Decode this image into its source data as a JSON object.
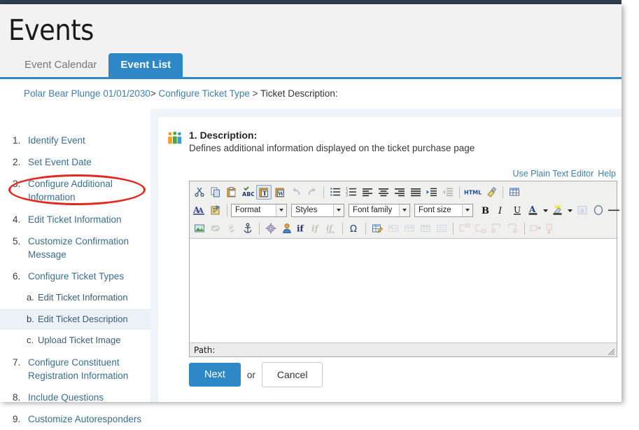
{
  "header": {
    "title": "Events",
    "tabs": [
      {
        "label": "Event Calendar",
        "active": false
      },
      {
        "label": "Event List",
        "active": true
      }
    ]
  },
  "breadcrumb": {
    "item1": "Polar Bear Plunge 01/01/2030",
    "sep1": ">",
    "item2": "Configure Ticket Type",
    "sep2": ">",
    "current": "Ticket Description:"
  },
  "sidebar": {
    "items": [
      {
        "num": "1.",
        "label": "Identify Event",
        "sub": false,
        "highlight": false
      },
      {
        "num": "2.",
        "label": "Set Event Date",
        "sub": false,
        "highlight": false
      },
      {
        "num": "3.",
        "label": "Configure Additional Information",
        "sub": false,
        "highlight": false
      },
      {
        "num": "4.",
        "label": "Edit Ticket Information",
        "sub": false,
        "highlight": false
      },
      {
        "num": "5.",
        "label": "Customize Confirmation Message",
        "sub": false,
        "highlight": false
      },
      {
        "num": "6.",
        "label": "Configure Ticket Types",
        "sub": false,
        "highlight": false
      },
      {
        "num": "a.",
        "label": "Edit Ticket Information",
        "sub": true,
        "highlight": false
      },
      {
        "num": "b.",
        "label": "Edit Ticket Description",
        "sub": true,
        "highlight": true
      },
      {
        "num": "c.",
        "label": "Upload Ticket Image",
        "sub": true,
        "highlight": false
      },
      {
        "num": "7.",
        "label": "Configure Constituent Registration Information",
        "sub": false,
        "highlight": false
      },
      {
        "num": "8.",
        "label": "Include Questions",
        "sub": false,
        "highlight": false
      },
      {
        "num": "9.",
        "label": "Customize Autoresponders",
        "sub": false,
        "highlight": false
      }
    ]
  },
  "main": {
    "section_icon": "people-group-icon",
    "section_title": "1. Description:",
    "section_subtitle": "Defines additional information displayed on the ticket purchase page",
    "editor_links": {
      "plain_text": "Use Plain Text Editor",
      "help": "Help"
    },
    "editor": {
      "content": "",
      "status_label": "Path:",
      "selects": [
        {
          "name": "format",
          "value": "Format"
        },
        {
          "name": "styles",
          "value": "Styles"
        },
        {
          "name": "font-family",
          "value": "Font family"
        },
        {
          "name": "font-size",
          "value": "Font size"
        }
      ],
      "toolbar_row1": [
        {
          "icon": "cut-icon",
          "state": "on"
        },
        {
          "icon": "copy-icon",
          "state": "on"
        },
        {
          "icon": "paste-icon",
          "state": "on"
        },
        {
          "icon": "spellcheck-icon",
          "state": "on"
        },
        {
          "icon": "paste-as-text-icon",
          "state": "active"
        },
        {
          "icon": "paste-from-word-icon",
          "state": "on"
        },
        {
          "icon": "undo-icon",
          "state": "disabled"
        },
        {
          "icon": "redo-icon",
          "state": "disabled"
        },
        {
          "icon": "separator",
          "state": "sep"
        },
        {
          "icon": "bullet-list-icon",
          "state": "on"
        },
        {
          "icon": "numbered-list-icon",
          "state": "on"
        },
        {
          "icon": "align-left-icon",
          "state": "on"
        },
        {
          "icon": "align-center-icon",
          "state": "on"
        },
        {
          "icon": "align-right-icon",
          "state": "on"
        },
        {
          "icon": "align-justify-icon",
          "state": "on"
        },
        {
          "icon": "indent-icon",
          "state": "on"
        },
        {
          "icon": "outdent-icon",
          "state": "disabled"
        },
        {
          "icon": "separator",
          "state": "sep"
        },
        {
          "icon": "html-source-icon",
          "state": "on"
        },
        {
          "icon": "clean-formatting-icon",
          "state": "on"
        },
        {
          "icon": "separator",
          "state": "sep"
        },
        {
          "icon": "insert-table-icon",
          "state": "on"
        }
      ],
      "toolbar_row3": [
        {
          "icon": "insert-image-icon",
          "state": "on"
        },
        {
          "icon": "insert-link-icon",
          "state": "disabled"
        },
        {
          "icon": "unlink-icon",
          "state": "disabled"
        },
        {
          "icon": "anchor-icon",
          "state": "on"
        },
        {
          "icon": "separator",
          "state": "sep"
        },
        {
          "icon": "advanced-settings-icon",
          "state": "on"
        },
        {
          "icon": "insert-person-icon",
          "state": "on"
        },
        {
          "icon": "merge-field-icon",
          "state": "on"
        },
        {
          "icon": "merge-field-edit-icon",
          "state": "disabled"
        },
        {
          "icon": "merge-field-insert-icon",
          "state": "disabled"
        },
        {
          "icon": "separator",
          "state": "sep"
        },
        {
          "icon": "special-character-icon",
          "state": "on"
        },
        {
          "icon": "separator",
          "state": "sep"
        },
        {
          "icon": "edit-table-properties-icon",
          "state": "on"
        },
        {
          "icon": "table-cell-props-icon",
          "state": "disabled"
        },
        {
          "icon": "merge-cells-icon",
          "state": "disabled"
        },
        {
          "icon": "split-cells-icon",
          "state": "disabled"
        },
        {
          "icon": "table-row-props-icon",
          "state": "disabled"
        },
        {
          "icon": "separator",
          "state": "sep"
        },
        {
          "icon": "insert-row-before-icon",
          "state": "disabled"
        },
        {
          "icon": "insert-row-after-icon",
          "state": "disabled"
        },
        {
          "icon": "insert-col-before-icon",
          "state": "disabled"
        },
        {
          "icon": "insert-col-after-icon",
          "state": "disabled"
        },
        {
          "icon": "separator",
          "state": "sep"
        },
        {
          "icon": "delete-row-icon",
          "state": "disabled"
        },
        {
          "icon": "delete-col-icon",
          "state": "disabled"
        }
      ]
    },
    "actions": {
      "next": "Next",
      "or": "or",
      "cancel": "Cancel"
    }
  },
  "colors": {
    "accent_blue": "#2e88c7",
    "link_blue": "#3d7faa",
    "topbar_navy": "#2c3e50",
    "panel_blue": "#eef4fa",
    "annotation_red": "#e02b22",
    "highlight_row": "#eaf2f8"
  }
}
